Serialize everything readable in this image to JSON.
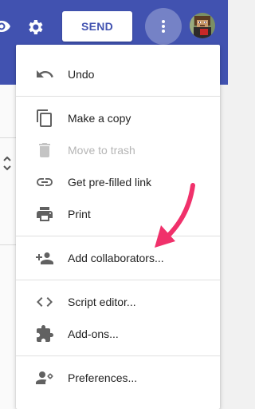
{
  "topbar": {
    "send_label": "SEND",
    "brand_color": "#4152b0"
  },
  "menu": {
    "items": [
      {
        "label": "Undo",
        "icon": "undo-icon"
      },
      {
        "label": "Make a copy",
        "icon": "copy-icon"
      },
      {
        "label": "Move to trash",
        "icon": "trash-icon",
        "disabled": true
      },
      {
        "label": "Get pre-filled link",
        "icon": "link-icon"
      },
      {
        "label": "Print",
        "icon": "printer-icon"
      },
      {
        "label": "Add collaborators...",
        "icon": "add-people-icon"
      },
      {
        "label": "Script editor...",
        "icon": "code-icon"
      },
      {
        "label": "Add-ons...",
        "icon": "puzzle-icon"
      },
      {
        "label": "Preferences...",
        "icon": "user-settings-icon"
      }
    ]
  },
  "annotation": {
    "arrow_color": "#f0316b"
  }
}
